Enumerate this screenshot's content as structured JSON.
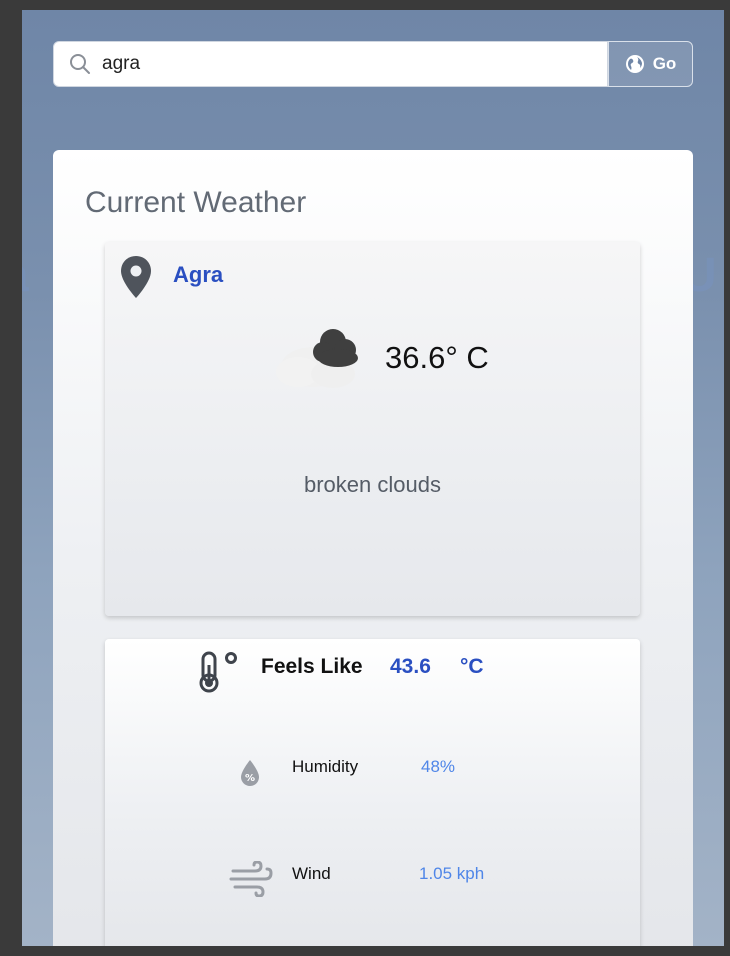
{
  "search": {
    "value": "agra",
    "go_label": "Go"
  },
  "card": {
    "title": "Current Weather"
  },
  "current": {
    "city": "Agra",
    "temperature": "36.6° C",
    "description": "broken clouds",
    "condition_icon": "broken-clouds-icon"
  },
  "details": {
    "feels_like_label": "Feels Like",
    "feels_like_value": "43.6",
    "feels_like_unit": "°C",
    "humidity_label": "Humidity",
    "humidity_value": "48%",
    "wind_label": "Wind",
    "wind_value": "1.05 kph"
  },
  "colors": {
    "accent": "#2a4fc1",
    "secondary_value": "#4f86e8",
    "background": "#7a90ae"
  }
}
